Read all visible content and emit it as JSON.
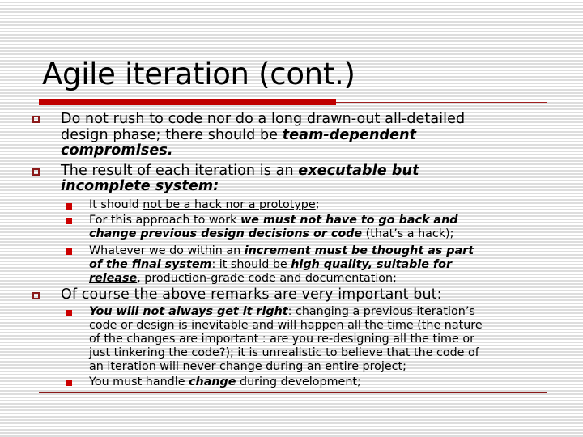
{
  "slide": {
    "title": "Agile iteration (cont.)",
    "bullets": [
      {
        "lines": [
          {
            "parts": [
              "Do not rush to code nor do a long drawn-out all-detailed"
            ]
          },
          {
            "parts": [
              "design phase; there should be ",
              "team-dependent"
            ]
          },
          {
            "parts": [
              "compromises."
            ]
          }
        ]
      },
      {
        "lines": [
          {
            "parts": [
              "The result of each iteration is an ",
              "executable but"
            ]
          },
          {
            "parts": [
              "incomplete system:"
            ]
          }
        ],
        "subbullets": [
          {
            "lines": [
              {
                "parts": [
                  "It should ",
                  "not be a hack nor a prototype",
                  ";"
                ]
              }
            ]
          },
          {
            "lines": [
              {
                "parts": [
                  "For this approach to work ",
                  "we must not have to go back and"
                ]
              },
              {
                "parts": [
                  "change previous design decisions or code",
                  " (that’s a hack);"
                ]
              }
            ]
          },
          {
            "lines": [
              {
                "parts": [
                  "Whatever we do within an ",
                  "increment must be thought as part"
                ]
              },
              {
                "parts": [
                  "of the final system",
                  ": it should be ",
                  "high quality, ",
                  "suitable for"
                ]
              },
              {
                "parts": [
                  "release",
                  ", production-grade code and documentation;"
                ]
              }
            ]
          }
        ]
      },
      {
        "lines": [
          {
            "parts": [
              "Of course the above remarks are very important but:"
            ]
          }
        ],
        "subbullets": [
          {
            "lines": [
              {
                "parts": [
                  "You will not always get it right",
                  ": changing a previous iteration’s"
                ]
              },
              {
                "parts": [
                  "code or design is inevitable and will happen all the time (the nature"
                ]
              },
              {
                "parts": [
                  "of the changes are important : are you re-designing all the time or"
                ]
              },
              {
                "parts": [
                  "just tinkering the code?); it is unrealistic to believe that the code of"
                ]
              },
              {
                "parts": [
                  "an iteration will never change during an entire project;"
                ]
              }
            ]
          },
          {
            "lines": [
              {
                "parts": [
                  "You must handle ",
                  "change",
                  " during development;"
                ]
              }
            ]
          }
        ]
      }
    ]
  },
  "colors": {
    "accent": "#c00000",
    "bullet_outline": "#8b1a1a",
    "sub_bullet_fill": "#cc0000",
    "stripe": "#dddddd"
  }
}
